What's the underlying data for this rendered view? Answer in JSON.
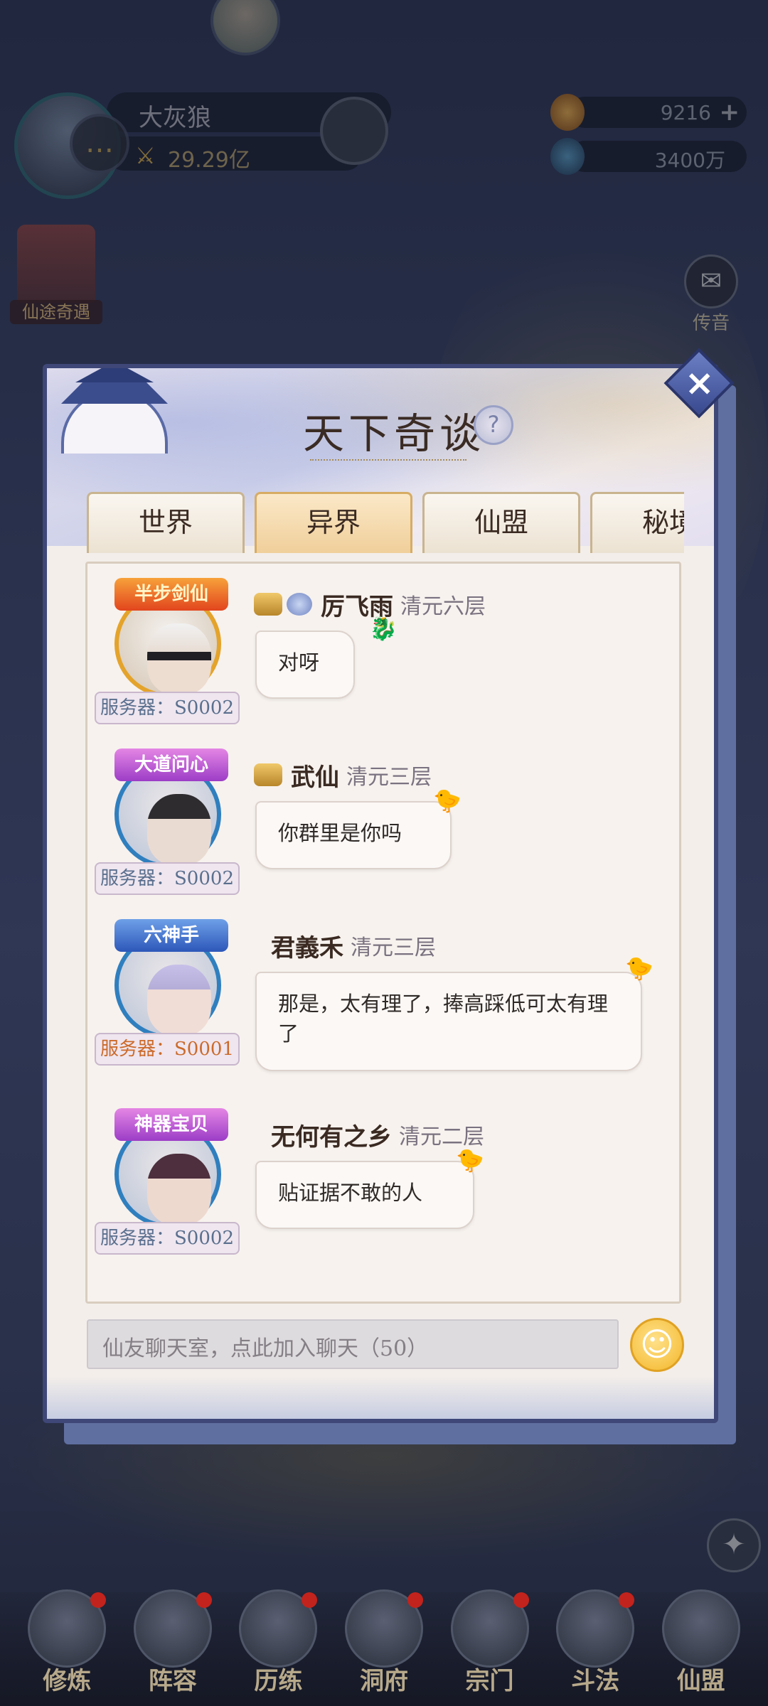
{
  "player": {
    "name": "大灰狼",
    "power": "29.29亿"
  },
  "resources": {
    "gems": "9216",
    "coins": "3400万"
  },
  "side": {
    "event_label": "仙途奇遇",
    "mail_label": "传音"
  },
  "dialog": {
    "title": "天下奇谈",
    "tabs": [
      {
        "label": "世界",
        "active": false
      },
      {
        "label": "异界",
        "active": true
      },
      {
        "label": "仙盟",
        "active": false
      },
      {
        "label": "秘境",
        "active": false
      }
    ],
    "messages": [
      {
        "title_badge": "半步剑仙",
        "name": "厉飞雨",
        "level": "清元六层",
        "text": "对呀",
        "server": "服务器：S0002"
      },
      {
        "title_badge": "大道问心",
        "name": "武仙",
        "level": "清元三层",
        "text": "你群里是你吗",
        "server": "服务器：S0002"
      },
      {
        "title_badge": "六神手",
        "name": "君義禾",
        "level": "清元三层",
        "text": "那是，太有理了，捧高踩低可太有理了",
        "server": "服务器：S0001"
      },
      {
        "title_badge": "神器宝贝",
        "name": "无何有之乡",
        "level": "清元二层",
        "text": "贴证据不敢的人",
        "server": "服务器：S0002"
      }
    ],
    "input_placeholder": "仙友聊天室，点此加入聊天（50）"
  },
  "bottom_nav": [
    {
      "label": "修炼"
    },
    {
      "label": "阵容"
    },
    {
      "label": "历练"
    },
    {
      "label": "洞府"
    },
    {
      "label": "宗门"
    },
    {
      "label": "斗法"
    },
    {
      "label": "仙盟"
    }
  ],
  "icons": {
    "close": "close-icon",
    "help": "help-icon",
    "emoji": "emoji-icon",
    "mail": "mail-icon",
    "chat": "chat-icon"
  },
  "colors": {
    "dialog_border": "#3e4778",
    "active_tab": "#f0cf9a",
    "server_alt": "#cc6a2a"
  }
}
